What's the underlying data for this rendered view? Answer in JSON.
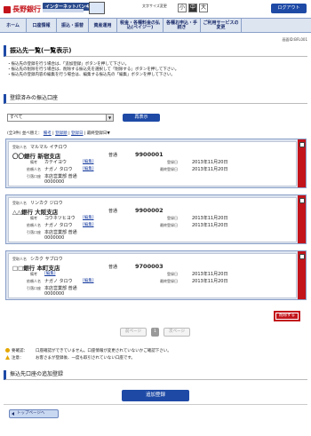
{
  "header": {
    "bank_name": "長野銀行",
    "service": "インターネットバンキング",
    "font_size_label": "文字サイズ変更",
    "font_small": "小",
    "font_medium": "中",
    "font_large": "大",
    "logout": "ログアウト"
  },
  "nav": [
    {
      "label": "ホーム"
    },
    {
      "label": "口座情報"
    },
    {
      "label": "振込・振替"
    },
    {
      "label": "資産運用"
    },
    {
      "label": "税金・各種料金の払込(ペイジー)"
    },
    {
      "label": "各種お申込・手続き"
    },
    {
      "label": "ご利用サービスの変更"
    }
  ],
  "screen_id": "画面ID:BFL001",
  "page_title": "振込先一覧(一覧表示)",
  "notes": [
    "・振込先の登録を行う場合は、「追加登録」ボタンを押して下さい。",
    "・振込先の削除を行う場合は、削除する振込先を選択して「削除する」ボタンを押して下さい。",
    "・振込先の登録内容の編集を行う場合は、編集する振込先の「編集」ボタンを押して下さい。"
  ],
  "registered_section": "登録済みの振込口座",
  "filter": {
    "selected": "すべて",
    "button": "再表示"
  },
  "sort": {
    "count": "(全3件)",
    "label": "並べ替え：",
    "options": [
      "備考",
      "登録順",
      "登録日",
      "最終登録日▼"
    ]
  },
  "labels": {
    "recipient": "受取人名",
    "remark": "備考",
    "requester": "依頼人名",
    "withdraw": "引落口座",
    "registered": "登録日",
    "last_used": "最終登録日",
    "edit": "[編集]"
  },
  "accounts": [
    {
      "recipient": "マルマル イチロウ",
      "bank": "〇〇銀行 新宿支店",
      "type": "普通",
      "number": "9900001",
      "remark": "カテイヨウ",
      "requester": "ナガノ タロウ",
      "withdraw_branch": "本店営業部 普通",
      "withdraw_number": "0000000",
      "registered": "2013年11月20日",
      "last_used": "2013年11月20日"
    },
    {
      "recipient": "リンカク ジロウ",
      "bank": "△△銀行 大阪支店",
      "type": "普通",
      "number": "9900002",
      "remark": "コウネツヒヨウ",
      "requester": "ナガノ タロウ",
      "withdraw_branch": "本店営業部 普通",
      "withdraw_number": "0000000",
      "registered": "2013年11月20日",
      "last_used": "2013年11月20日"
    },
    {
      "recipient": "シカク サブロウ",
      "bank": "□□銀行 本町支店",
      "type": "普通",
      "number": "9700003",
      "remark": "",
      "requester": "ナガノ タロウ",
      "withdraw_branch": "本店営業部 普通",
      "withdraw_number": "0000000",
      "registered": "2013年11月20日",
      "last_used": "2013年11月20日"
    }
  ],
  "delete_button": "削除する",
  "pager": {
    "prev": "前ページ",
    "current": "1",
    "next": "次ページ"
  },
  "legend": [
    {
      "key": "要確認：",
      "text": "口座確認ができていません。口座情報が変更されていないかご確認下さい。"
    },
    {
      "key": "注意：",
      "text": "お客さまが登録後、一度も取引されていない口座です。"
    }
  ],
  "add_section": "振込先口座の追加登録",
  "add_button": "追加登録",
  "top_page": "トップページへ"
}
